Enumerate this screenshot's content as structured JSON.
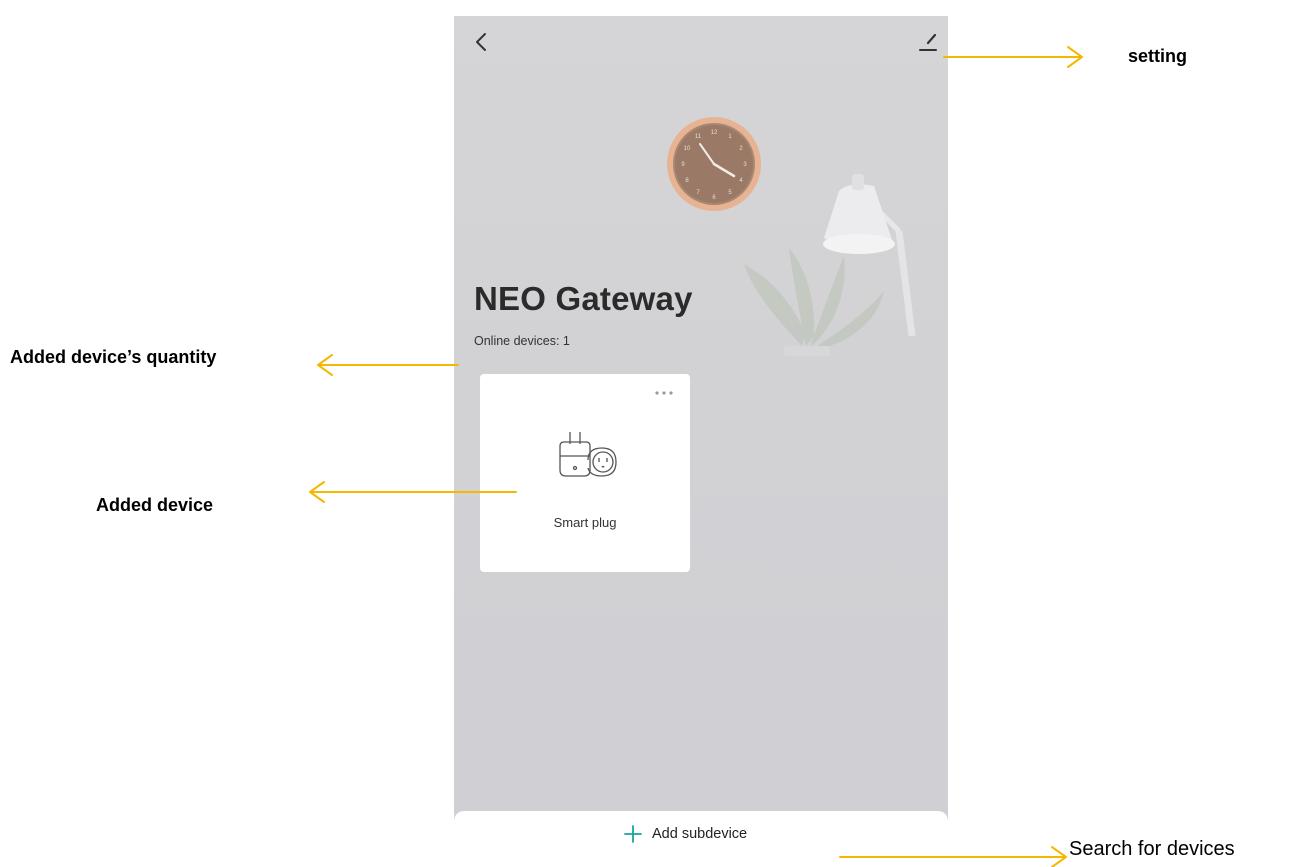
{
  "app": {
    "title": "NEO Gateway",
    "online_label": "Online devices: 1",
    "back_icon": "chevron-left-icon",
    "edit_icon": "pencil-icon"
  },
  "devices": [
    {
      "name": "Smart plug",
      "icon": "smart-plug-icon",
      "menu_icon": "more-dots-icon"
    }
  ],
  "bottom_bar": {
    "add_label": "Add subdevice",
    "add_icon": "plus-icon",
    "accent": "#1aa39a"
  },
  "annotations": {
    "setting": "setting",
    "quantity": "Added device’s quantity",
    "device": "Added device",
    "search": "Search for devices",
    "arrow_color": "#f5b800"
  }
}
